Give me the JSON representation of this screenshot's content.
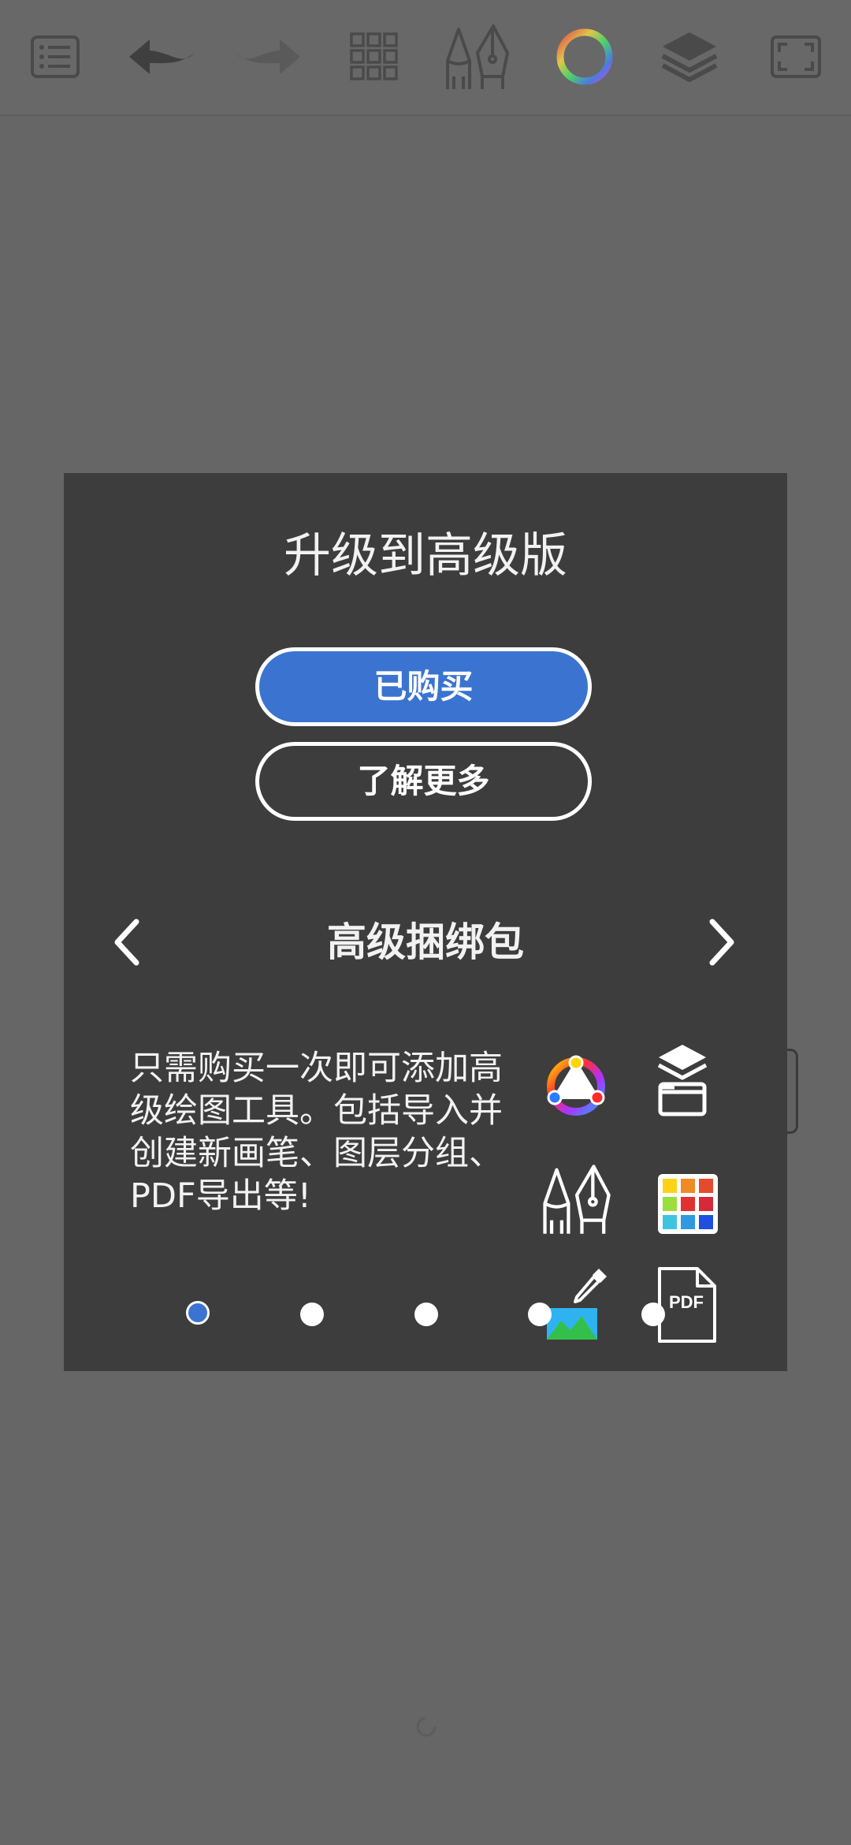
{
  "toolbar": {
    "icons": [
      "list-icon",
      "undo-icon",
      "redo-icon",
      "grid-icon",
      "brushes-icon",
      "color-wheel-icon",
      "layers-icon",
      "fullscreen-icon"
    ]
  },
  "modal": {
    "title": "升级到高级版",
    "purchased_label": "已购买",
    "learn_more_label": "了解更多",
    "section_title": "高级捆绑包",
    "description": "只需购买一次即可添加高级绘图工具。包括导入并创建新画笔、图层分组、PDF导出等!",
    "pdf_label": "PDF",
    "feature_icons": [
      "color-harmony-icon",
      "layer-group-icon",
      "brush-pens-icon",
      "color-palette-icon",
      "eyedropper-image-icon",
      "pdf-export-icon"
    ],
    "page_count": 5,
    "active_page": 1
  },
  "colors": {
    "background": "#666666",
    "modal": "#3d3d3d",
    "accent": "#3b74d0",
    "text": "#f2f2f2"
  }
}
